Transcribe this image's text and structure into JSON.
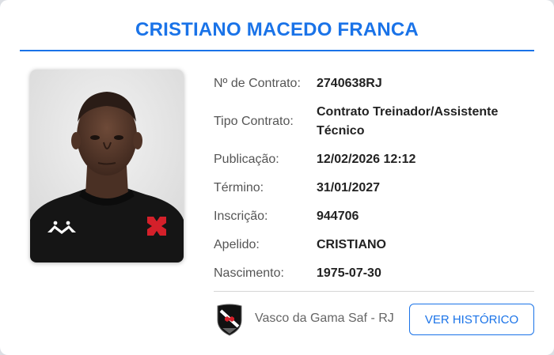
{
  "person": {
    "name": "CRISTIANO MACEDO FRANCA",
    "photo_icon": "person-photo"
  },
  "details": [
    {
      "label": "Nº de Contrato:",
      "value": "2740638RJ"
    },
    {
      "label": "Tipo Contrato:",
      "value": "Contrato Treinador/Assistente Técnico"
    },
    {
      "label": "Publicação:",
      "value": "12/02/2026 12:12"
    },
    {
      "label": "Término:",
      "value": "31/01/2027"
    },
    {
      "label": "Inscrição:",
      "value": "944706"
    },
    {
      "label": "Apelido:",
      "value": "CRISTIANO"
    },
    {
      "label": "Nascimento:",
      "value": "1975-07-30"
    }
  ],
  "footer": {
    "club_name": "Vasco da Gama Saf - RJ",
    "crest_icon": "club-crest-icon",
    "history_button": "VER HISTÓRICO"
  },
  "colors": {
    "accent": "#1a73e8",
    "label": "#555555",
    "value": "#222222",
    "cross_red": "#d4202a"
  }
}
